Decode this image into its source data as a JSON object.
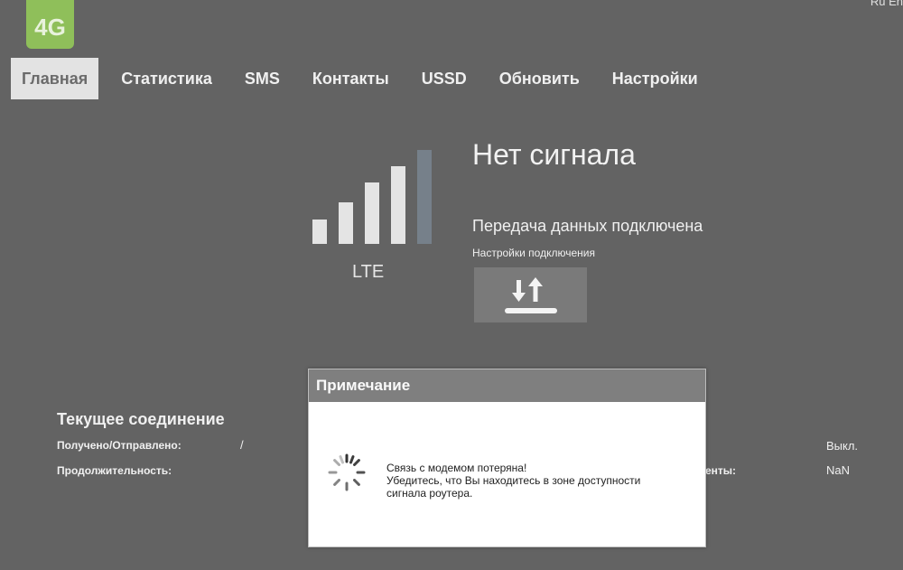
{
  "header": {
    "logo_text": "4G",
    "top_right_text": "Ru  En"
  },
  "nav": {
    "items": [
      {
        "label": "Главная",
        "active": true
      },
      {
        "label": "Статистика"
      },
      {
        "label": "SMS"
      },
      {
        "label": "Контакты"
      },
      {
        "label": "USSD"
      },
      {
        "label": "Обновить"
      },
      {
        "label": "Настройки"
      }
    ]
  },
  "status": {
    "network_type": "LTE",
    "signal_title": "Нет сигнала",
    "signal_bars_lit": 4,
    "signal_bars_total": 5,
    "data_status": "Передача данных подключена",
    "connection_settings_link": "Настройки подключения",
    "toggle_icon": "upload-download-icon"
  },
  "current_connection": {
    "title": "Текущее соединение",
    "received_sent_label": "Получено/Отправлено:",
    "received_sent_value": "/",
    "duration_label": "Продолжительность:",
    "right_value_1": "Выкл.",
    "right_label_2_partial": "енты:",
    "right_value_2": "NaN"
  },
  "modal": {
    "title": "Примечание",
    "message_line1": "Связь с модемом потеряна!",
    "message_line2": "Убедитесь, что Вы находитесь в зоне доступности",
    "message_line3": "сигнала роутера.",
    "icon": "loading-spinner-icon"
  }
}
